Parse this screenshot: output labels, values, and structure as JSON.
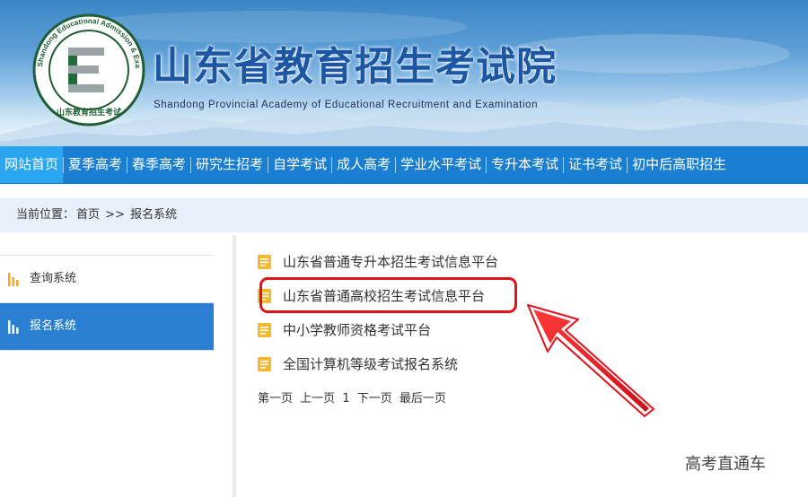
{
  "header": {
    "title": "山东省教育招生考试院",
    "subtitle": "Shandong Provincial Academy of Educational Recruitment and Examination",
    "logo_ring_text": "Shandong Educational Admission & Examinations",
    "logo_bottom_text": "山东教育招生考试"
  },
  "nav": {
    "items": [
      {
        "label": "网站首页",
        "active": true
      },
      {
        "label": "夏季高考"
      },
      {
        "label": "春季高考"
      },
      {
        "label": "研究生招考"
      },
      {
        "label": "自学考试"
      },
      {
        "label": "成人高考"
      },
      {
        "label": "学业水平考试"
      },
      {
        "label": "专升本考试"
      },
      {
        "label": "证书考试"
      },
      {
        "label": "初中后高职招生"
      }
    ]
  },
  "breadcrumb": {
    "prefix": "当前位置：",
    "home": "首页",
    "separator": ">>",
    "current": "报名系统"
  },
  "sidebar": {
    "items": [
      {
        "label": "查询系统",
        "active": false
      },
      {
        "label": "报名系统",
        "active": true
      }
    ]
  },
  "list": {
    "items": [
      {
        "label": "山东省普通专升本招生考试信息平台"
      },
      {
        "label": "山东省普通高校招生考试信息平台",
        "highlighted": true
      },
      {
        "label": "中小学教师资格考试平台"
      },
      {
        "label": "全国计算机等级考试报名系统"
      }
    ]
  },
  "pager": {
    "first": "第一页",
    "prev": "上一页",
    "page": "1",
    "next": "下一页",
    "last": "最后一页"
  },
  "watermark": "高考直通车",
  "colors": {
    "nav_bg": "#1a7fd1",
    "nav_active": "#2aa6f0",
    "sidebar_active": "#2a7fd3",
    "breadcrumb_bg": "#e8f1fb",
    "highlight_red": "#e0121b",
    "doc_icon": "#f5b82e",
    "title_blue": "#1d56a3"
  }
}
